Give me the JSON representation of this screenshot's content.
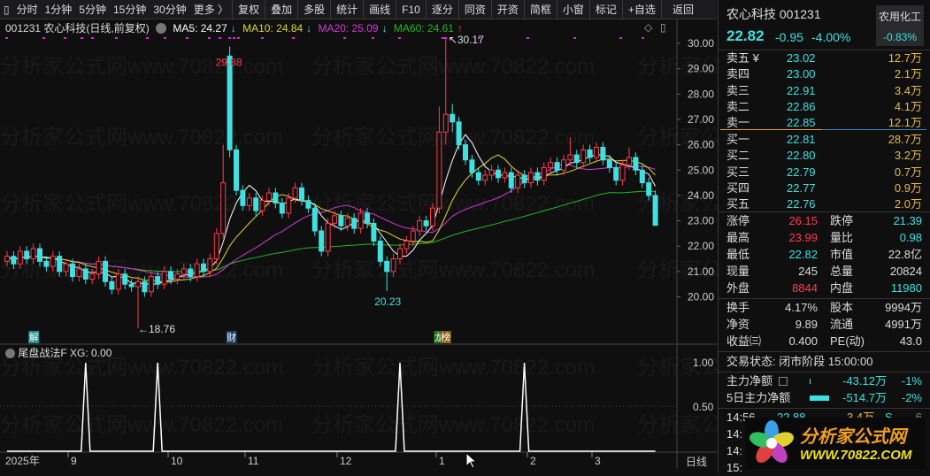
{
  "toolbar": {
    "items": [
      "分时",
      "1分钟",
      "5分钟",
      "15分钟",
      "30分钟",
      "更多 〉"
    ],
    "buttons": [
      "复权",
      "叠加",
      "多股",
      "统计",
      "画线",
      "F10",
      "逐分",
      "同资",
      "开资",
      "简框",
      "小窗",
      "标记",
      "+自选",
      "返回"
    ]
  },
  "info": {
    "title": "001231 农心科技(日线,前复权)",
    "ma5": "MA5: 24.27",
    "ma10": "MA10: 24.84",
    "ma20": "MA20: 25.09",
    "ma60": "MA60: 24.61",
    "ma5_dir": "↓",
    "ma10_dir": "↓",
    "ma20_dir": "↓",
    "ma60_dir": "↑"
  },
  "colors": {
    "up": "#ff3b4b",
    "down": "#3fe0e0",
    "ma5": "#ffffff",
    "ma10": "#e0d830",
    "ma20": "#d838d8",
    "ma60": "#22b822",
    "bg": "#0f0f10"
  },
  "chart_data": [
    {
      "type": "candlestick",
      "ylim": [
        19.5,
        30.5
      ],
      "yticks": [
        "30.00",
        "29.00",
        "28.00",
        "27.00",
        "26.00",
        "25.00",
        "24.00",
        "23.00",
        "22.00",
        "21.00",
        "20.00"
      ],
      "xticks": [
        "2025年",
        "9",
        "10",
        "11",
        "12",
        "1",
        "2",
        "3"
      ],
      "period_label": "日线",
      "bars": [
        [
          21.4,
          21.8,
          21.2,
          21.6
        ],
        [
          21.6,
          21.8,
          21.1,
          21.3
        ],
        [
          21.3,
          22.0,
          21.1,
          21.8
        ],
        [
          21.8,
          22.0,
          21.3,
          21.5
        ],
        [
          21.5,
          22.1,
          21.3,
          21.9
        ],
        [
          21.9,
          22.1,
          21.2,
          21.4
        ],
        [
          21.4,
          21.6,
          21.0,
          21.2
        ],
        [
          21.2,
          21.8,
          21.0,
          21.6
        ],
        [
          21.6,
          21.8,
          20.8,
          21.0
        ],
        [
          21.0,
          21.5,
          20.8,
          21.3
        ],
        [
          21.3,
          21.5,
          20.6,
          20.8
        ],
        [
          20.8,
          21.3,
          20.6,
          21.1
        ],
        [
          21.1,
          21.3,
          20.5,
          20.7
        ],
        [
          20.7,
          21.1,
          20.5,
          20.9
        ],
        [
          20.9,
          21.6,
          20.7,
          21.4
        ],
        [
          21.4,
          21.6,
          20.4,
          20.6
        ],
        [
          20.6,
          20.8,
          20.1,
          20.3
        ],
        [
          20.3,
          21.1,
          20.1,
          20.9
        ],
        [
          20.9,
          21.1,
          20.3,
          20.5
        ],
        [
          20.5,
          20.7,
          20.2,
          20.4
        ],
        [
          20.4,
          20.8,
          18.76,
          20.6
        ],
        [
          20.6,
          20.8,
          20.0,
          20.2
        ],
        [
          20.2,
          21.0,
          20.0,
          20.8
        ],
        [
          20.8,
          21.0,
          20.3,
          20.5
        ],
        [
          20.5,
          21.2,
          20.3,
          21.0
        ],
        [
          21.0,
          21.2,
          20.5,
          20.7
        ],
        [
          20.7,
          21.1,
          20.5,
          20.9
        ],
        [
          20.9,
          21.3,
          20.7,
          21.1
        ],
        [
          21.1,
          21.3,
          20.6,
          20.8
        ],
        [
          20.8,
          21.5,
          20.6,
          21.3
        ],
        [
          21.3,
          21.5,
          20.8,
          21.0
        ],
        [
          21.0,
          21.7,
          20.8,
          21.5
        ],
        [
          21.5,
          22.7,
          21.3,
          22.5
        ],
        [
          22.5,
          26.0,
          22.3,
          24.5
        ],
        [
          29.5,
          29.88,
          25.5,
          25.8
        ],
        [
          25.8,
          26.0,
          24.0,
          24.2
        ],
        [
          24.2,
          24.4,
          23.4,
          23.6
        ],
        [
          23.6,
          24.1,
          23.4,
          23.9
        ],
        [
          23.9,
          24.1,
          23.2,
          23.4
        ],
        [
          23.4,
          24.0,
          23.2,
          23.8
        ],
        [
          23.8,
          24.3,
          23.6,
          24.1
        ],
        [
          24.1,
          24.3,
          23.5,
          23.7
        ],
        [
          23.7,
          23.9,
          23.1,
          23.3
        ],
        [
          23.3,
          24.1,
          23.1,
          23.9
        ],
        [
          23.9,
          24.5,
          23.7,
          24.3
        ],
        [
          24.3,
          24.5,
          23.6,
          23.8
        ],
        [
          23.8,
          24.0,
          23.3,
          23.5
        ],
        [
          23.5,
          23.7,
          22.4,
          22.6
        ],
        [
          22.6,
          22.8,
          21.6,
          21.8
        ],
        [
          21.8,
          23.1,
          21.6,
          22.9
        ],
        [
          22.9,
          23.4,
          22.7,
          23.2
        ],
        [
          23.2,
          23.4,
          22.6,
          22.8
        ],
        [
          22.8,
          23.3,
          22.6,
          23.1
        ],
        [
          23.1,
          23.3,
          22.5,
          22.7
        ],
        [
          22.7,
          23.5,
          22.5,
          23.3
        ],
        [
          23.3,
          23.5,
          22.7,
          22.9
        ],
        [
          22.9,
          23.1,
          22.0,
          22.2
        ],
        [
          22.2,
          22.4,
          21.2,
          21.4
        ],
        [
          21.4,
          21.6,
          20.23,
          21.0
        ],
        [
          21.0,
          21.7,
          20.8,
          21.5
        ],
        [
          21.5,
          22.1,
          21.3,
          21.9
        ],
        [
          21.9,
          22.4,
          21.7,
          22.2
        ],
        [
          22.2,
          22.8,
          22.0,
          22.6
        ],
        [
          22.6,
          23.2,
          22.4,
          23.0
        ],
        [
          23.0,
          23.2,
          22.6,
          22.8
        ],
        [
          22.8,
          23.7,
          22.6,
          23.5
        ],
        [
          23.5,
          27.5,
          23.3,
          26.5
        ],
        [
          26.5,
          30.17,
          26.0,
          27.2
        ],
        [
          27.2,
          27.6,
          26.5,
          26.9
        ],
        [
          26.9,
          27.1,
          25.8,
          26.0
        ],
        [
          26.0,
          26.2,
          25.2,
          25.4
        ],
        [
          25.4,
          25.6,
          24.7,
          24.9
        ],
        [
          24.9,
          25.1,
          24.4,
          24.6
        ],
        [
          24.6,
          25.0,
          24.4,
          24.8
        ],
        [
          24.8,
          25.2,
          24.6,
          25.0
        ],
        [
          25.0,
          25.2,
          24.5,
          24.7
        ],
        [
          24.7,
          25.1,
          24.5,
          24.9
        ],
        [
          24.9,
          25.1,
          24.1,
          24.3
        ],
        [
          24.3,
          25.0,
          24.1,
          24.8
        ],
        [
          24.8,
          25.0,
          24.3,
          24.5
        ],
        [
          24.5,
          25.1,
          24.3,
          24.9
        ],
        [
          24.9,
          25.1,
          24.4,
          24.6
        ],
        [
          24.6,
          25.3,
          24.4,
          25.1
        ],
        [
          25.1,
          25.5,
          24.9,
          25.3
        ],
        [
          25.3,
          25.5,
          24.8,
          25.0
        ],
        [
          25.0,
          25.6,
          24.8,
          25.4
        ],
        [
          25.4,
          26.3,
          25.2,
          25.6
        ],
        [
          25.6,
          25.8,
          25.1,
          25.3
        ],
        [
          25.3,
          26.0,
          25.1,
          25.8
        ],
        [
          25.8,
          26.0,
          25.3,
          25.5
        ],
        [
          25.5,
          26.1,
          25.3,
          25.9
        ],
        [
          25.9,
          26.1,
          25.2,
          25.4
        ],
        [
          25.4,
          25.6,
          24.9,
          25.1
        ],
        [
          25.1,
          25.3,
          24.4,
          24.6
        ],
        [
          24.6,
          25.4,
          24.4,
          25.2
        ],
        [
          25.2,
          25.9,
          25.0,
          25.5
        ],
        [
          25.5,
          25.7,
          24.8,
          25.0
        ],
        [
          25.0,
          25.2,
          24.3,
          24.5
        ],
        [
          24.5,
          24.7,
          23.8,
          24.0
        ],
        [
          24.0,
          24.2,
          22.82,
          22.82
        ]
      ],
      "annotations": [
        {
          "bar": 34,
          "value": "29.88",
          "kind": "high"
        },
        {
          "bar": 67,
          "value": "30.17",
          "kind": "high"
        },
        {
          "bar": 20,
          "value": "18.76",
          "kind": "low"
        },
        {
          "bar": 58,
          "value": "20.23",
          "kind": "low"
        }
      ],
      "event_markers": [
        {
          "bar": 3,
          "label": "解",
          "color": "#1a8a8a"
        },
        {
          "bar": 34,
          "label": "财",
          "color": "#1a3f6a"
        },
        {
          "bar": 66,
          "label": "龙",
          "color": "#1f7a1f"
        },
        {
          "bar": 67,
          "label": "榜",
          "color": "#8a5a14"
        }
      ]
    },
    {
      "type": "line",
      "title": "尾盘战法F",
      "series_label": "XG: 0.00",
      "ylim": [
        0,
        1
      ],
      "yticks": [
        "1.00",
        "0.50"
      ],
      "signal_bars": [
        12,
        23,
        60,
        79
      ]
    }
  ],
  "quote": {
    "name": "农心科技 001231",
    "price": "22.82",
    "change": "-0.95",
    "pct": "-4.00%",
    "sector": "农用化工",
    "sector_pct": "-0.83%"
  },
  "orderbook": {
    "asks": [
      {
        "label": "卖五 ¥",
        "price": "23.02",
        "vol": "12.7万"
      },
      {
        "label": "卖四",
        "price": "23.00",
        "vol": "2.1万"
      },
      {
        "label": "卖三",
        "price": "22.91",
        "vol": "3.4万"
      },
      {
        "label": "卖二",
        "price": "22.86",
        "vol": "4.1万"
      },
      {
        "label": "卖一",
        "price": "22.85",
        "vol": "12.1万"
      }
    ],
    "bids": [
      {
        "label": "买一",
        "price": "22.81",
        "vol": "28.7万"
      },
      {
        "label": "买二",
        "price": "22.80",
        "vol": "3.2万"
      },
      {
        "label": "买三",
        "price": "22.79",
        "vol": "0.7万"
      },
      {
        "label": "买四",
        "price": "22.77",
        "vol": "0.9万"
      },
      {
        "label": "买五",
        "price": "22.76",
        "vol": "2.0万"
      }
    ]
  },
  "stats": [
    {
      "l1": "涨停",
      "v1": "26.15",
      "c1": "red",
      "l2": "跌停",
      "v2": "21.39",
      "c2": "cyan"
    },
    {
      "l1": "最高",
      "v1": "23.99",
      "c1": "red",
      "l2": "量比",
      "v2": "0.98",
      "c2": "cyan"
    },
    {
      "l1": "最低",
      "v1": "22.82",
      "c1": "cyan",
      "l2": "市值",
      "v2": "22.8亿",
      "c2": "wht"
    },
    {
      "l1": "现量",
      "v1": "245",
      "c1": "wht",
      "l2": "总量",
      "v2": "20824",
      "c2": "wht"
    },
    {
      "l1": "外盘",
      "v1": "8844",
      "c1": "red",
      "l2": "内盘",
      "v2": "11980",
      "c2": "cyan"
    }
  ],
  "stats2": [
    {
      "l1": "换手",
      "v1": "4.17%",
      "l2": "股本",
      "v2": "9994万"
    },
    {
      "l1": "净资",
      "v1": "9.89",
      "l2": "流通",
      "v2": "4991万"
    },
    {
      "l1": "收益㈢",
      "v1": "0.400",
      "l2": "PE(动)",
      "v2": "43.0"
    }
  ],
  "trade_status": "交易状态: 闭市阶段 15:00:00",
  "capital": [
    {
      "label": "主力净额",
      "amount": "-43.12万",
      "pct": "-1%",
      "bar": 0.05
    },
    {
      "label": "5日主力净额",
      "amount": "-514.7万",
      "pct": "-2%",
      "bar": 1.0
    }
  ],
  "ticks": [
    {
      "time": "14:56",
      "price": "22.88",
      "vol": "3.4万",
      "side": "S",
      "count": "6"
    },
    {
      "time": "14:"
    },
    {
      "time": "14:"
    },
    {
      "time": "15:"
    }
  ],
  "watermark": "分析家公式网www.70822.com",
  "logo": {
    "title": "分析家公式网",
    "url": "WWW.70822.COM"
  }
}
